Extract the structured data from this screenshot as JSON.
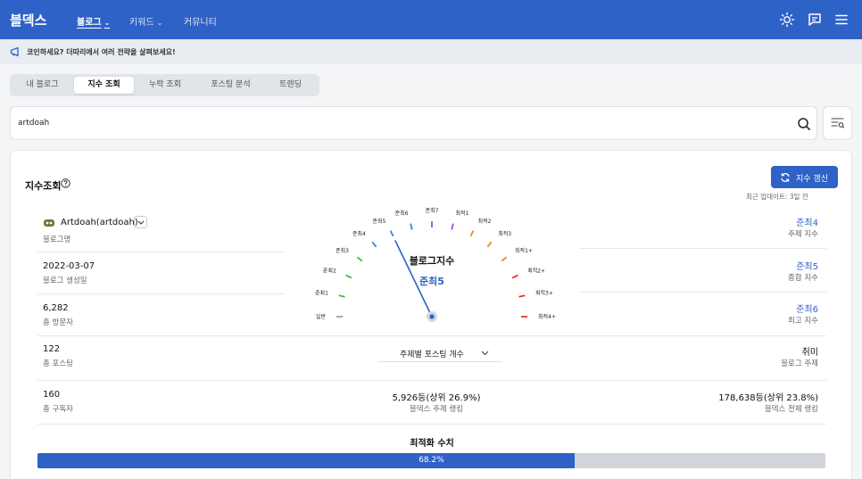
{
  "app": {
    "logo": "블덱스"
  },
  "nav": [
    {
      "label": "블로그",
      "chevron": "⌄",
      "active": true
    },
    {
      "label": "키워드",
      "chevron": "⌄",
      "active": false
    },
    {
      "label": "커뮤니티",
      "chevron": "",
      "active": false
    }
  ],
  "top_icons": [
    "sun-icon",
    "chat-icon",
    "menu-icon"
  ],
  "notice": {
    "icon": "megaphone-icon",
    "text": "코인하세요? 더따리에서 여러 전략을 살펴보세요!"
  },
  "tabs": [
    "내 블로그",
    "지수 조회",
    "누락 조회",
    "포스팅 분석",
    "트렌딩"
  ],
  "active_tab": 1,
  "search": {
    "value": "artdoah"
  },
  "card": {
    "title": "지수조회",
    "refresh_label": "지수 갱신",
    "updated": "최근 업데이트:  3일 전"
  },
  "blog": {
    "name": "Artdoah(artdoah)",
    "name_label": "블로그명",
    "created": "2022-03-07",
    "created_label": "블로그 생성일",
    "visitors": "6,282",
    "visitors_label": "총 방문자",
    "posts": "122",
    "posts_label": "총 포스팅",
    "subscribers": "160",
    "subscribers_label": "총 구독자"
  },
  "gauge": {
    "title": "블로그지수",
    "value": "준최5",
    "value_index": 5,
    "ticks": [
      {
        "label": "일반",
        "color": "#9aa3ad"
      },
      {
        "label": "준최1",
        "color": "#35c24a"
      },
      {
        "label": "준최2",
        "color": "#35c24a"
      },
      {
        "label": "준최3",
        "color": "#35c24a"
      },
      {
        "label": "준최4",
        "color": "#2e86de"
      },
      {
        "label": "준최5",
        "color": "#2e86de"
      },
      {
        "label": "준최6",
        "color": "#2e86de"
      },
      {
        "label": "준최7",
        "color": "#9b4fd6"
      },
      {
        "label": "최적1",
        "color": "#9b4fd6"
      },
      {
        "label": "최적2",
        "color": "#f08a1c"
      },
      {
        "label": "최적3",
        "color": "#f08a1c"
      },
      {
        "label": "최적1+",
        "color": "#f08a1c"
      },
      {
        "label": "최적2+",
        "color": "#e8322b"
      },
      {
        "label": "최적3+",
        "color": "#e8322b"
      },
      {
        "label": "최적4+",
        "color": "#e8322b"
      }
    ]
  },
  "indices": {
    "topic": "준최4",
    "topic_label": "주제 지수",
    "overall": "준최5",
    "overall_label": "종합 지수",
    "max": "준최6",
    "max_label": "최고 지수"
  },
  "topic_dropdown": "주제별 포스팅 개수",
  "hobby": {
    "value": "취미",
    "label": "블로그 주제"
  },
  "ranking": {
    "topic": "5,926등(상위 26.9%)",
    "topic_label": "블덱스 주제 랭킹",
    "all": "178,638등(상위 23.8%)",
    "all_label": "블덱스 전체 랭킹"
  },
  "optimization": {
    "label": "최적화 수치",
    "value_text": "68.2%",
    "percent": 68.2
  },
  "colors": {
    "brand": "#2f62c6",
    "track": "#d1d5da"
  }
}
